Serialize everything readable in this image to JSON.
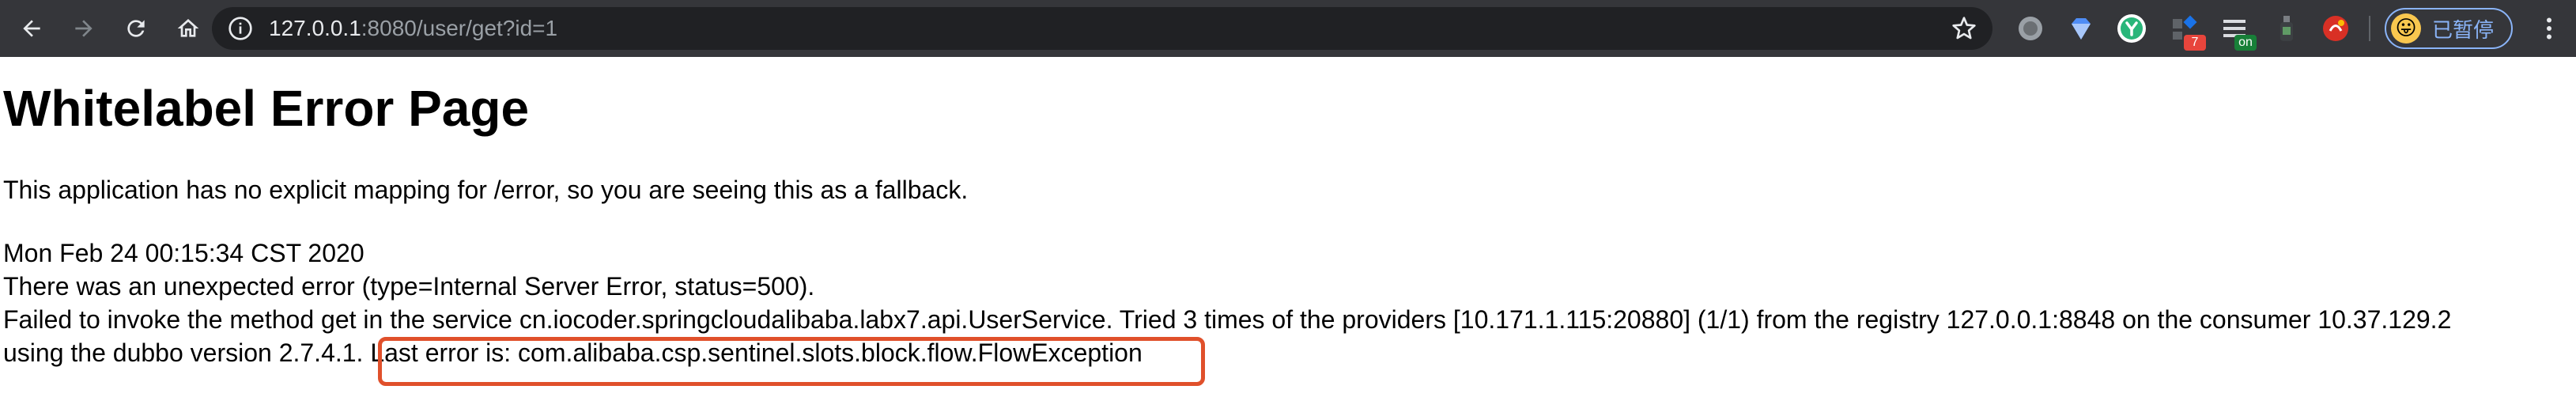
{
  "browser": {
    "url_host": "127.0.0.1",
    "url_rest": ":8080/user/get?id=1",
    "profile_label": "已暂停",
    "extensions": [
      {
        "name": "gray-circle-icon",
        "badge": ""
      },
      {
        "name": "diamond-icon",
        "badge": ""
      },
      {
        "name": "yapi-icon",
        "badge": ""
      },
      {
        "name": "puzzle-icon",
        "badge": "7"
      },
      {
        "name": "list-icon",
        "badge": "on"
      },
      {
        "name": "bottle-icon",
        "badge": ""
      },
      {
        "name": "red-extension-icon",
        "badge": ""
      }
    ],
    "colors": {
      "toolbar": "#35363a",
      "omnibox": "#202124",
      "highlight": "#e0502b",
      "badge_red": "#e8453c",
      "badge_green": "#188038"
    }
  },
  "page": {
    "title": "Whitelabel Error Page",
    "fallback_message": "This application has no explicit mapping for /error, so you are seeing this as a fallback.",
    "timestamp": "Mon Feb 24 00:15:34 CST 2020",
    "error_summary": "There was an unexpected error (type=Internal Server Error, status=500).",
    "detail_line1": "Failed to invoke the method get in the service cn.iocoder.springcloudalibaba.labx7.api.UserService. Tried 3 times of the providers [10.171.1.115:20880] (1/1) from the registry 127.0.0.1:8848 on the consumer 10.37.129.2",
    "detail_line2_prefix": "using the dubbo version 2.7.4.1.",
    "detail_line2_highlight": "Last error is: com.alibaba.csp.sentinel.slots.block.flow.FlowException"
  }
}
